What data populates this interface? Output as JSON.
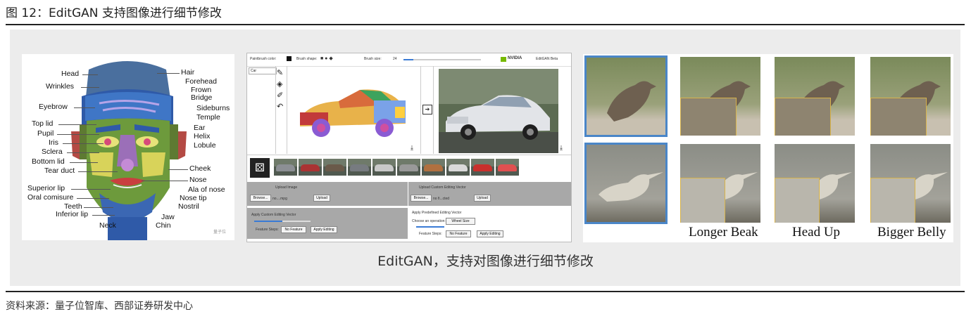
{
  "figure_title": "图 12：EditGAN 支持图像进行细节修改",
  "source_note": "资料来源：量子位智库、西部证券研发中心",
  "caption": "EditGAN，支持对图像进行细节修改",
  "face": {
    "left_labels": [
      "Head",
      "Wrinkles",
      "Eyebrow",
      "Top lid",
      "Pupil",
      "Iris",
      "Sclera",
      "Bottom lid",
      "Tear duct",
      "Superior lip",
      "Oral comisure",
      "Teeth",
      "Inferior lip",
      "Neck"
    ],
    "right_labels": [
      "Hair",
      "Forehead",
      "Frown",
      "Bridge",
      "Sideburns",
      "Temple",
      "Ear",
      "Helix",
      "Lobule",
      "Cheek",
      "Nose",
      "Ala of nose",
      "Nose tip",
      "Nostril",
      "Jaw",
      "Chin"
    ],
    "watermark": "量子位"
  },
  "editor": {
    "toolbar": {
      "brush_color_label": "Paintbrush color:",
      "brush_shape_label": "Brush shape:",
      "brush_size_label": "Brush size:",
      "brush_size_value": "24",
      "brand": "NVIDIA",
      "app_name": "EditGAN Beta"
    },
    "mode_value": "Car",
    "upload_image_label": "Upload Image",
    "upload_vector_label": "Upload Custom Editing Vector",
    "browse_label": "Browse...",
    "file_placeholder": "no....mpg",
    "file_placeholder_2": "no fi...cted",
    "upload_button": "Upload",
    "apply_custom_label": "Apply Custom Editing Vector",
    "apply_predefined_label": "Apply Predefined Editing Vector",
    "feature_steps_label": "Feature Steps:",
    "feature_steps_value": "No Feature",
    "choose_operation_label": "Choose an operation:",
    "choose_operation_value": "Wheel Size",
    "apply_editing_button": "Apply Editing"
  },
  "birds": {
    "labels": [
      "Longer Beak",
      "Head Up",
      "Bigger Belly"
    ],
    "colors": {
      "highlight": "#4a86c8",
      "zoom_box": "#d8b34a"
    }
  }
}
